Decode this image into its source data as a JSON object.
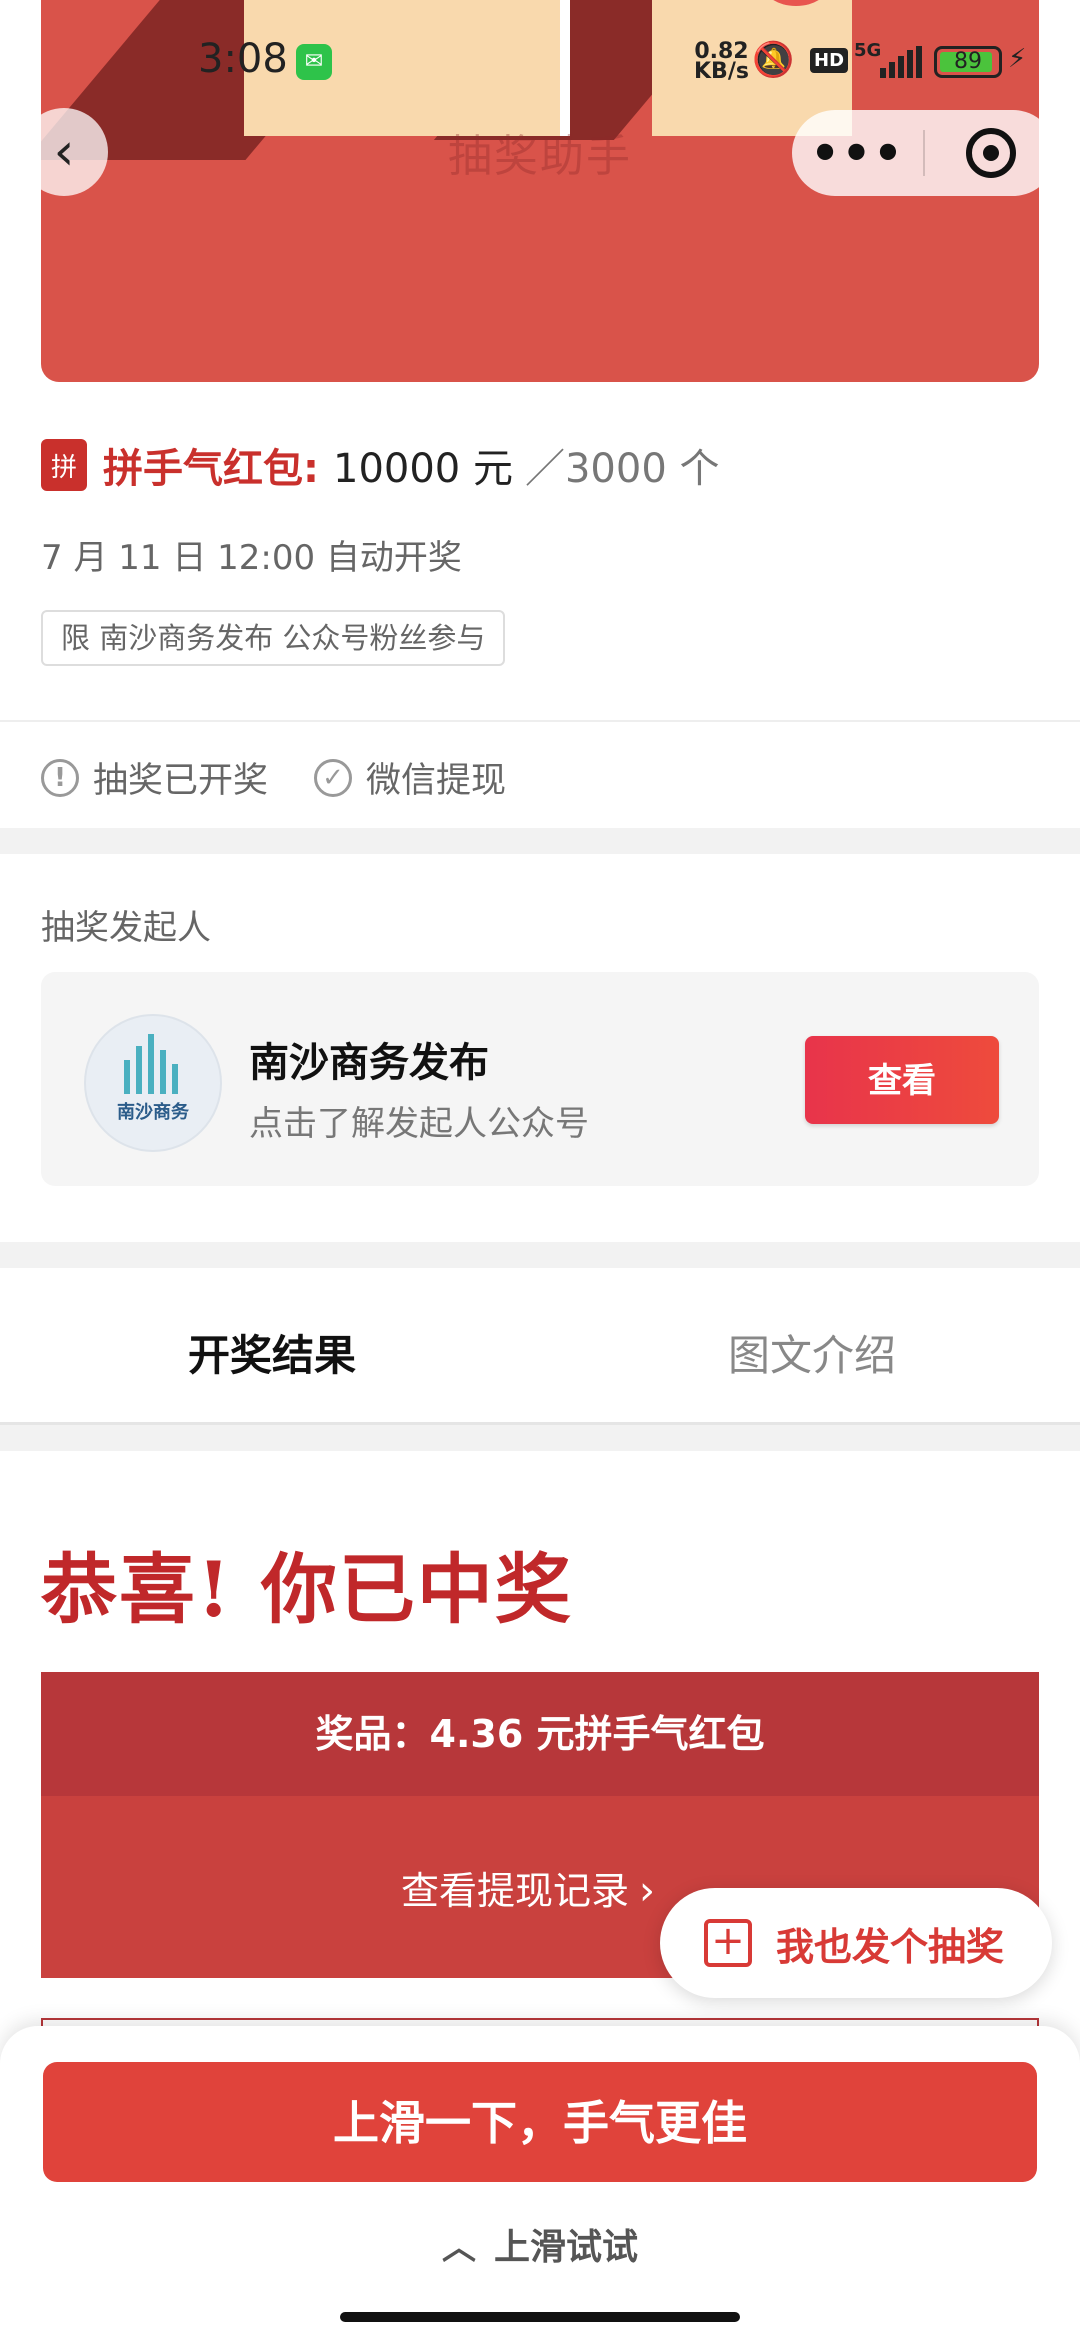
{
  "status_bar": {
    "time": "3:08",
    "net_speed_value": "0.82",
    "net_speed_unit": "KB/s",
    "hd": "HD",
    "network": "5G",
    "battery": "89"
  },
  "banner": {
    "faded_title": "抽奖助手"
  },
  "prize": {
    "icon_text": "拼",
    "label": "拼手气红包:",
    "amount": "10000 元",
    "count": "／3000 个",
    "draw_time": "7 月 11 日 12:00 自动开奖",
    "limit": "限 南沙商务发布 公众号粉丝参与"
  },
  "lottery_status": {
    "drawn": "抽奖已开奖",
    "withdraw": "微信提现"
  },
  "organizer": {
    "section_label": "抽奖发起人",
    "avatar_text": "南沙商务",
    "name": "南沙商务发布",
    "desc": "点击了解发起人公众号",
    "view_button": "查看"
  },
  "tabs": {
    "result": "开奖结果",
    "intro": "图文介绍"
  },
  "result": {
    "congrats": "恭喜! 你已中奖",
    "prize_line": "奖品：4.36 元拼手气红包",
    "withdraw_record": "查看提现记录"
  },
  "fab": {
    "label": "我也发个抽奖"
  },
  "bottom": {
    "swipe_button": "上滑一下，手气更佳",
    "swipe_hint": "上滑试试"
  },
  "colors": {
    "brand_red": "#c9302c",
    "button_red": "#e0433b",
    "banner_red": "#d9534a"
  }
}
